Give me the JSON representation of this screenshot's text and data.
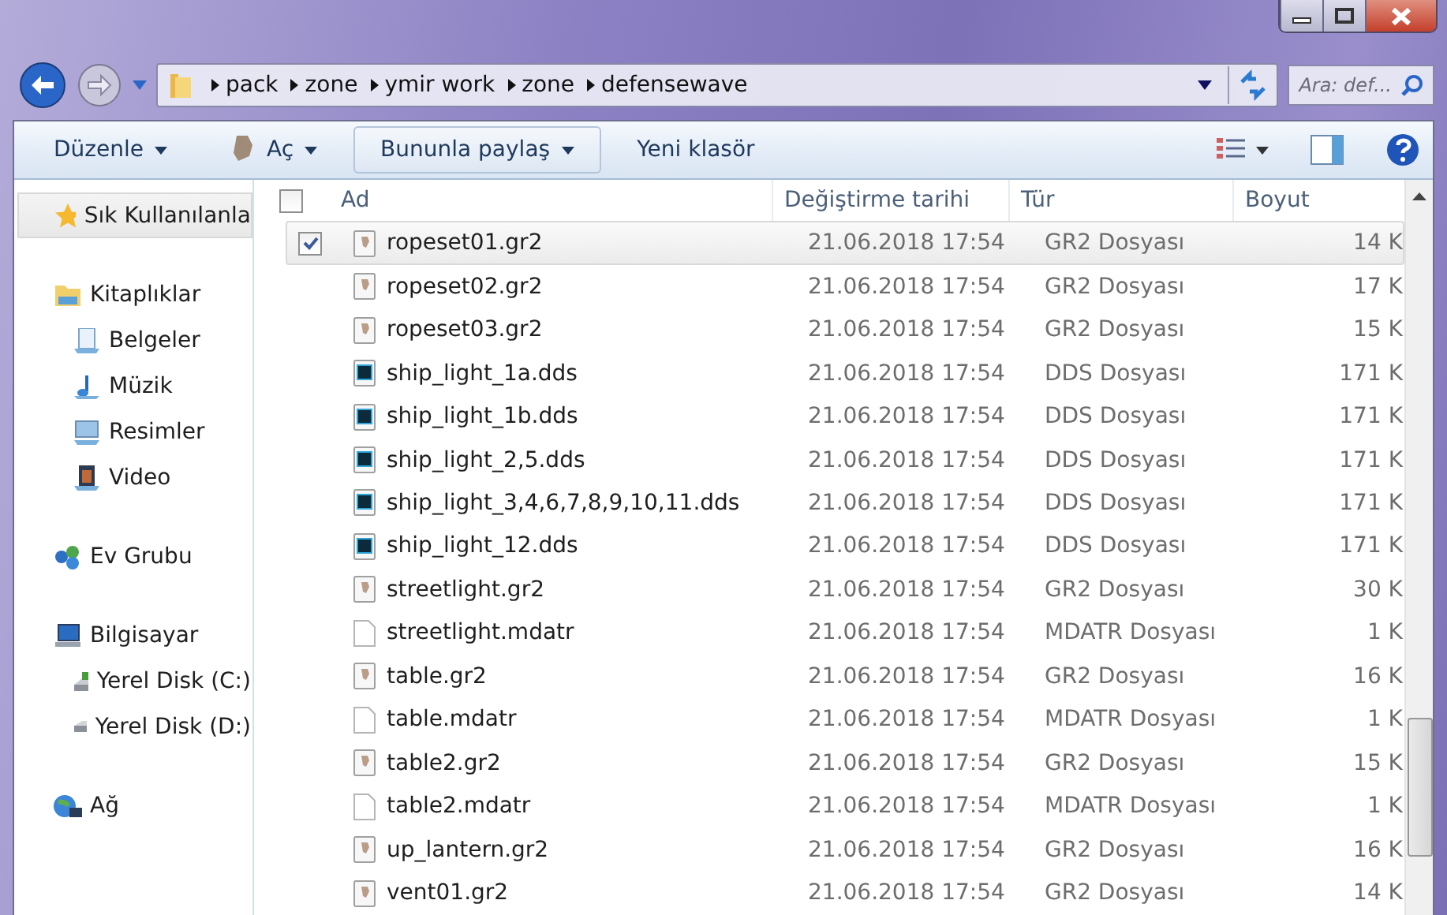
{
  "address_bar": {
    "path": [
      "pack",
      "zone",
      "ymir work",
      "zone",
      "defensewave"
    ]
  },
  "search": {
    "placeholder": "Ara: def..."
  },
  "toolbar": {
    "items": [
      {
        "label": "Düzenle",
        "kind": "menu"
      },
      {
        "label": "Aç",
        "kind": "open"
      },
      {
        "label": "Bununla paylaş",
        "kind": "pressed"
      },
      {
        "label": "Yeni klasör",
        "kind": "plain"
      }
    ]
  },
  "sidebar": {
    "groups": [
      {
        "label": "Sık Kullanılanla",
        "kind": "star",
        "selected": true
      },
      {
        "label": "Kitaplıklar",
        "kind": "library",
        "selected": false,
        "children": [
          {
            "label": "Belgeler",
            "kind": "docs"
          },
          {
            "label": "Müzik",
            "kind": "music"
          },
          {
            "label": "Resimler",
            "kind": "pictures"
          },
          {
            "label": "Video",
            "kind": "video"
          }
        ]
      },
      {
        "label": "Ev Grubu",
        "kind": "homegroup",
        "selected": false
      },
      {
        "label": "Bilgisayar",
        "kind": "computer",
        "selected": false,
        "children": [
          {
            "label": "Yerel Disk (C:)",
            "kind": "sysdisk"
          },
          {
            "label": "Yerel Disk (D:)",
            "kind": "disk"
          }
        ]
      },
      {
        "label": "Ağ",
        "kind": "network",
        "selected": false
      }
    ]
  },
  "table": {
    "columns": [
      "Ad",
      "Değiştirme tarihi",
      "Tür",
      "Boyut"
    ],
    "all_checked": false,
    "rows": [
      {
        "name": "ropeset01.gr2",
        "date": "21.06.2018 17:54",
        "type": "GR2 Dosyası",
        "size": "14 K",
        "kind": "gr2",
        "checked": true,
        "selected": true
      },
      {
        "name": "ropeset02.gr2",
        "date": "21.06.2018 17:54",
        "type": "GR2 Dosyası",
        "size": "17 K",
        "kind": "gr2",
        "checked": false,
        "selected": false
      },
      {
        "name": "ropeset03.gr2",
        "date": "21.06.2018 17:54",
        "type": "GR2 Dosyası",
        "size": "15 K",
        "kind": "gr2",
        "checked": false,
        "selected": false
      },
      {
        "name": "ship_light_1a.dds",
        "date": "21.06.2018 17:54",
        "type": "DDS Dosyası",
        "size": "171 K",
        "kind": "dds",
        "checked": false,
        "selected": false
      },
      {
        "name": "ship_light_1b.dds",
        "date": "21.06.2018 17:54",
        "type": "DDS Dosyası",
        "size": "171 K",
        "kind": "dds",
        "checked": false,
        "selected": false
      },
      {
        "name": "ship_light_2,5.dds",
        "date": "21.06.2018 17:54",
        "type": "DDS Dosyası",
        "size": "171 K",
        "kind": "dds",
        "checked": false,
        "selected": false
      },
      {
        "name": "ship_light_3,4,6,7,8,9,10,11.dds",
        "date": "21.06.2018 17:54",
        "type": "DDS Dosyası",
        "size": "171 K",
        "kind": "dds",
        "checked": false,
        "selected": false
      },
      {
        "name": "ship_light_12.dds",
        "date": "21.06.2018 17:54",
        "type": "DDS Dosyası",
        "size": "171 K",
        "kind": "dds",
        "checked": false,
        "selected": false
      },
      {
        "name": "streetlight.gr2",
        "date": "21.06.2018 17:54",
        "type": "GR2 Dosyası",
        "size": "30 K",
        "kind": "gr2",
        "checked": false,
        "selected": false
      },
      {
        "name": "streetlight.mdatr",
        "date": "21.06.2018 17:54",
        "type": "MDATR Dosyası",
        "size": "1 K",
        "kind": "blank",
        "checked": false,
        "selected": false
      },
      {
        "name": "table.gr2",
        "date": "21.06.2018 17:54",
        "type": "GR2 Dosyası",
        "size": "16 K",
        "kind": "gr2",
        "checked": false,
        "selected": false
      },
      {
        "name": "table.mdatr",
        "date": "21.06.2018 17:54",
        "type": "MDATR Dosyası",
        "size": "1 K",
        "kind": "blank",
        "checked": false,
        "selected": false
      },
      {
        "name": "table2.gr2",
        "date": "21.06.2018 17:54",
        "type": "GR2 Dosyası",
        "size": "15 K",
        "kind": "gr2",
        "checked": false,
        "selected": false
      },
      {
        "name": "table2.mdatr",
        "date": "21.06.2018 17:54",
        "type": "MDATR Dosyası",
        "size": "1 K",
        "kind": "blank",
        "checked": false,
        "selected": false
      },
      {
        "name": "up_lantern.gr2",
        "date": "21.06.2018 17:54",
        "type": "GR2 Dosyası",
        "size": "16 K",
        "kind": "gr2",
        "checked": false,
        "selected": false
      },
      {
        "name": "vent01.gr2",
        "date": "21.06.2018 17:54",
        "type": "GR2 Dosyası",
        "size": "14 K",
        "kind": "gr2",
        "checked": false,
        "selected": false
      }
    ]
  }
}
